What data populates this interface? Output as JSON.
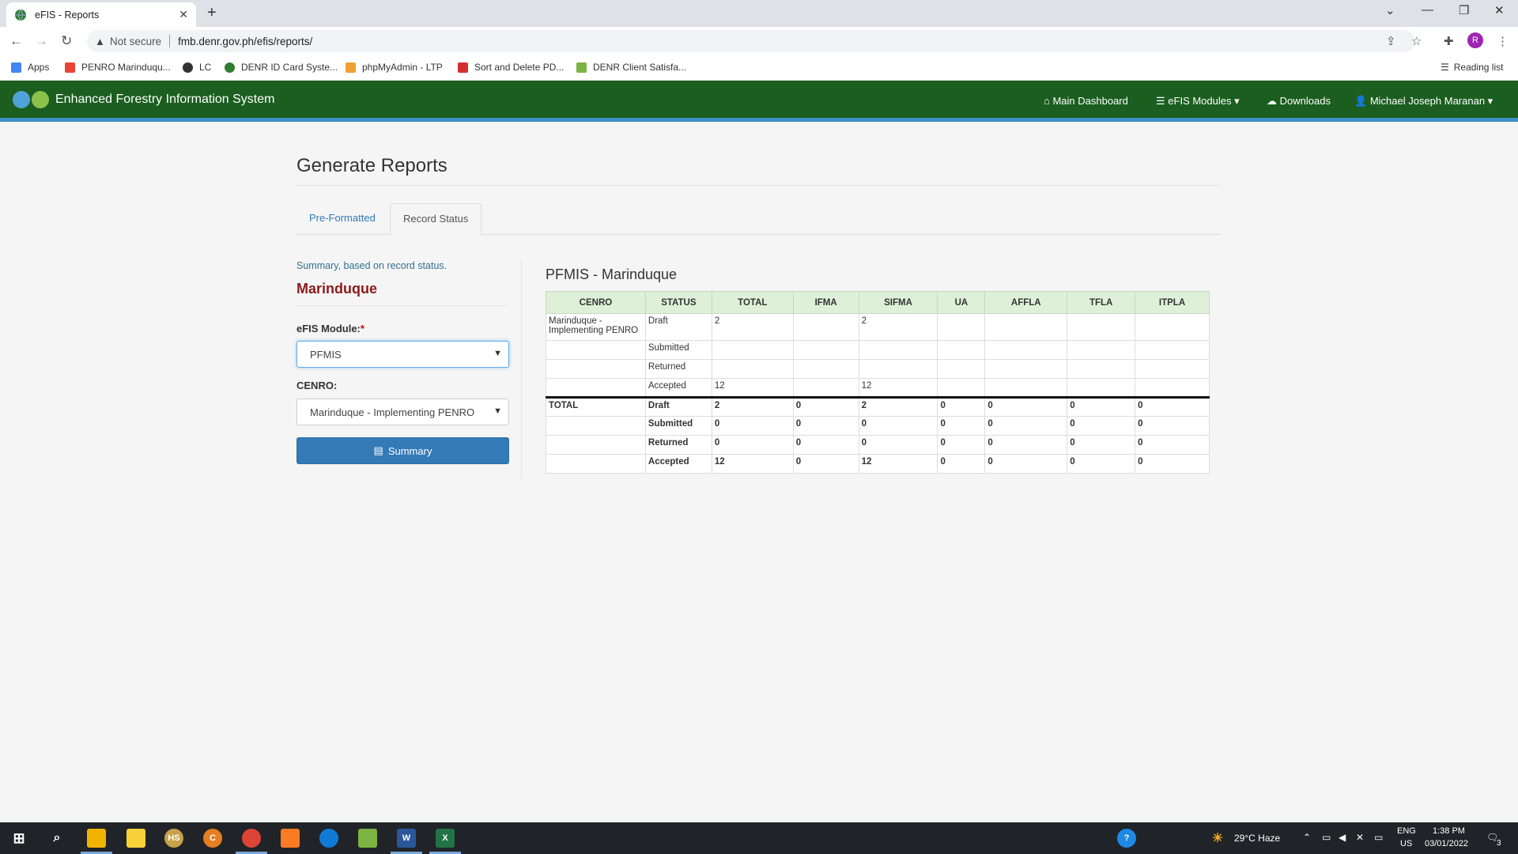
{
  "browser": {
    "tab_title": "eFIS - Reports",
    "security_label": "Not secure",
    "url": "fmb.denr.gov.ph/efis/reports/",
    "profile_initial": "R",
    "reading_list": "Reading list"
  },
  "bookmarks": [
    {
      "label": "Apps"
    },
    {
      "label": "PENRO Marinduqu..."
    },
    {
      "label": "LC"
    },
    {
      "label": "DENR ID Card Syste..."
    },
    {
      "label": "phpMyAdmin - LTP"
    },
    {
      "label": "Sort and Delete PD..."
    },
    {
      "label": "DENR Client Satisfa..."
    }
  ],
  "app": {
    "brand": "Enhanced Forestry Information System",
    "nav": {
      "main_dashboard": "Main Dashboard",
      "efis_modules": "eFIS Modules",
      "downloads": "Downloads",
      "user": "Michael Joseph Maranan"
    }
  },
  "page": {
    "title": "Generate Reports",
    "tabs": [
      "Pre-Formatted",
      "Record Status"
    ],
    "summary_note": "Summary, based on record status.",
    "province": "Marinduque",
    "module_label": "eFIS Module:",
    "required_mark": "*",
    "module_value": "PFMIS",
    "cenro_label": "CENRO:",
    "cenro_value": "Marinduque - Implementing PENRO",
    "summary_button": "Summary"
  },
  "report": {
    "title": "PFMIS - Marinduque",
    "headers": [
      "CENRO",
      "STATUS",
      "TOTAL",
      "IFMA",
      "SIFMA",
      "UA",
      "AFFLA",
      "TFLA",
      "ITPLA"
    ],
    "rows": [
      [
        "Marinduque - Implementing PENRO",
        "Draft",
        "2",
        "",
        "2",
        "",
        "",
        "",
        ""
      ],
      [
        "",
        "Submitted",
        "",
        "",
        "",
        "",
        "",
        "",
        ""
      ],
      [
        "",
        "Returned",
        "",
        "",
        "",
        "",
        "",
        "",
        ""
      ],
      [
        "",
        "Accepted",
        "12",
        "",
        "12",
        "",
        "",
        "",
        ""
      ]
    ],
    "totals": [
      [
        "TOTAL",
        "Draft",
        "2",
        "0",
        "2",
        "0",
        "0",
        "0",
        "0"
      ],
      [
        "",
        "Submitted",
        "0",
        "0",
        "0",
        "0",
        "0",
        "0",
        "0"
      ],
      [
        "",
        "Returned",
        "0",
        "0",
        "0",
        "0",
        "0",
        "0",
        "0"
      ],
      [
        "",
        "Accepted",
        "12",
        "0",
        "12",
        "0",
        "0",
        "0",
        "0"
      ]
    ]
  },
  "taskbar": {
    "weather": "29°C Haze",
    "lang": "ENG",
    "region": "US",
    "time": "1:38 PM",
    "date": "03/01/2022",
    "notifications": "3"
  },
  "colors": {
    "navbar": "#1b5e20",
    "navbar_accent": "#3b8fc4",
    "primary": "#337ab7",
    "province": "#8b1a1a",
    "table_header": "#dff0d8"
  }
}
